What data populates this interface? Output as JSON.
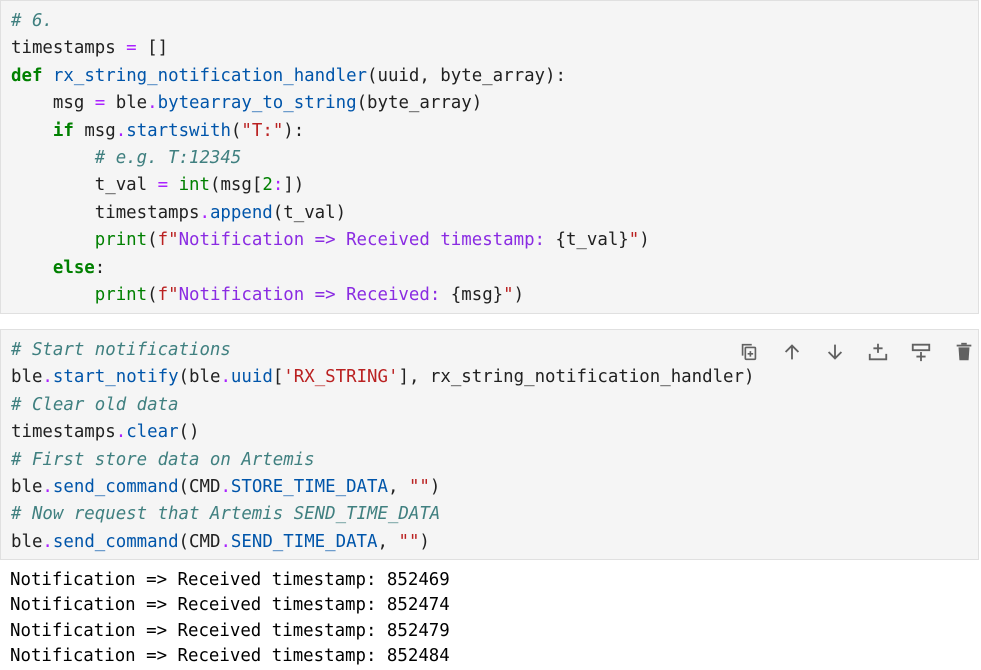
{
  "cell1": {
    "lines": [
      [
        [
          "c",
          "# 6."
        ]
      ],
      [
        [
          "p",
          "timestamps "
        ],
        [
          "o",
          "="
        ],
        [
          "p",
          " "
        ],
        [
          "p",
          "[]"
        ]
      ],
      [
        [
          "k",
          "def"
        ],
        [
          "p",
          " "
        ],
        [
          "f",
          "rx_string_notification_handler"
        ],
        [
          "p",
          "(uuid, byte_array):"
        ]
      ],
      [
        [
          "p",
          "    msg "
        ],
        [
          "o",
          "="
        ],
        [
          "p",
          " ble"
        ],
        [
          "o",
          "."
        ],
        [
          "f",
          "bytearray_to_string"
        ],
        [
          "p",
          "(byte_array)"
        ]
      ],
      [
        [
          "p",
          "    "
        ],
        [
          "k",
          "if"
        ],
        [
          "p",
          " msg"
        ],
        [
          "o",
          "."
        ],
        [
          "f",
          "startswith"
        ],
        [
          "p",
          "("
        ],
        [
          "s",
          "\"T:\""
        ],
        [
          "p",
          "):"
        ]
      ],
      [
        [
          "p",
          "        "
        ],
        [
          "c",
          "# e.g. T:12345"
        ]
      ],
      [
        [
          "p",
          "        t_val "
        ],
        [
          "o",
          "="
        ],
        [
          "p",
          " "
        ],
        [
          "b",
          "int"
        ],
        [
          "p",
          "(msg["
        ],
        [
          "i",
          "2"
        ],
        [
          "o",
          ":"
        ],
        [
          "p",
          "])"
        ]
      ],
      [
        [
          "p",
          "        timestamps"
        ],
        [
          "o",
          "."
        ],
        [
          "f",
          "append"
        ],
        [
          "p",
          "(t_val)"
        ]
      ],
      [
        [
          "p",
          "        "
        ],
        [
          "b",
          "print"
        ],
        [
          "p",
          "("
        ],
        [
          "s",
          "f\""
        ],
        [
          "sp",
          "Notification => Received timestamp: "
        ],
        [
          "p",
          "{t_val}"
        ],
        [
          "s",
          "\""
        ],
        [
          "p",
          ")"
        ]
      ],
      [
        [
          "p",
          "    "
        ],
        [
          "k",
          "else"
        ],
        [
          "p",
          ":"
        ]
      ],
      [
        [
          "p",
          "        "
        ],
        [
          "b",
          "print"
        ],
        [
          "p",
          "("
        ],
        [
          "s",
          "f\""
        ],
        [
          "sp",
          "Notification => Received: "
        ],
        [
          "p",
          "{msg}"
        ],
        [
          "s",
          "\""
        ],
        [
          "p",
          ")"
        ]
      ]
    ]
  },
  "cell2": {
    "lines": [
      [
        [
          "c",
          "# Start notifications"
        ]
      ],
      [
        [
          "p",
          "ble"
        ],
        [
          "o",
          "."
        ],
        [
          "f",
          "start_notify"
        ],
        [
          "p",
          "(ble"
        ],
        [
          "o",
          "."
        ],
        [
          "f",
          "uuid"
        ],
        [
          "p",
          "["
        ],
        [
          "s",
          "'RX_STRING'"
        ],
        [
          "p",
          "], rx_string_notification_handler)"
        ]
      ],
      [
        [
          "c",
          "# Clear old data"
        ]
      ],
      [
        [
          "p",
          "timestamps"
        ],
        [
          "o",
          "."
        ],
        [
          "f",
          "clear"
        ],
        [
          "p",
          "()"
        ]
      ],
      [
        [
          "c",
          "# First store data on Artemis"
        ]
      ],
      [
        [
          "p",
          "ble"
        ],
        [
          "o",
          "."
        ],
        [
          "f",
          "send_command"
        ],
        [
          "p",
          "(CMD"
        ],
        [
          "o",
          "."
        ],
        [
          "f",
          "STORE_TIME_DATA"
        ],
        [
          "p",
          ", "
        ],
        [
          "s",
          "\"\""
        ],
        [
          "p",
          ")"
        ]
      ],
      [
        [
          "c",
          "# Now request that Artemis SEND_TIME_DATA"
        ]
      ],
      [
        [
          "p",
          "ble"
        ],
        [
          "o",
          "."
        ],
        [
          "f",
          "send_command"
        ],
        [
          "p",
          "(CMD"
        ],
        [
          "o",
          "."
        ],
        [
          "f",
          "SEND_TIME_DATA"
        ],
        [
          "p",
          ", "
        ],
        [
          "s",
          "\"\""
        ],
        [
          "p",
          ")"
        ]
      ]
    ]
  },
  "toolbar": {
    "icons": [
      "duplicate-icon",
      "move-up-icon",
      "move-down-icon",
      "insert-above-icon",
      "insert-below-icon",
      "delete-icon"
    ]
  },
  "output": {
    "lines": [
      "Notification => Received timestamp: 852469",
      "Notification => Received timestamp: 852474",
      "Notification => Received timestamp: 852479",
      "Notification => Received timestamp: 852484"
    ]
  },
  "colors": {
    "cell_bg": "#f5f5f5",
    "comment": "#408080",
    "keyword": "#008000",
    "function": "#0055aa",
    "string": "#ba2121",
    "toolbar_icon": "#616161"
  }
}
